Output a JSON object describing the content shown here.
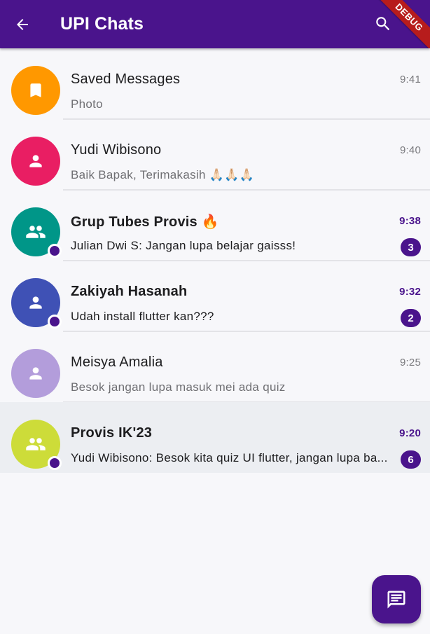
{
  "app_bar": {
    "title": "UPI Chats",
    "back_icon": "arrow-back-icon",
    "search_icon": "search-icon",
    "debug_label": "DEBUG",
    "background": "#4a148c"
  },
  "chats": [
    {
      "name": "Saved Messages",
      "message": "Photo",
      "time": "9:41",
      "avatar_icon": "bookmark-icon",
      "avatar_color": "#ff9800",
      "online": false,
      "unread": ""
    },
    {
      "name": "Yudi Wibisono",
      "message": "Baik Bapak, Terimakasih 🙏🏻🙏🏻🙏🏻",
      "time": "9:40",
      "avatar_icon": "person-icon",
      "avatar_color": "#e91e63",
      "online": false,
      "unread": ""
    },
    {
      "name": "Grup Tubes Provis 🔥",
      "message": "Julian Dwi S: Jangan lupa belajar gaisss!",
      "time": "9:38",
      "avatar_icon": "group-icon",
      "avatar_color": "#009688",
      "online": true,
      "unread": "3"
    },
    {
      "name": "Zakiyah Hasanah",
      "message": "Udah install flutter kan???",
      "time": "9:32",
      "avatar_icon": "person-icon",
      "avatar_color": "#3f51b5",
      "online": true,
      "unread": "2"
    },
    {
      "name": "Meisya Amalia",
      "message": "Besok jangan lupa masuk mei ada quiz",
      "time": "9:25",
      "avatar_icon": "person-icon",
      "avatar_color": "#b39ddb",
      "online": false,
      "unread": ""
    },
    {
      "name": "Provis IK'23",
      "message": "Yudi Wibisono: Besok kita quiz UI flutter, jangan lupa ba...",
      "time": "9:20",
      "avatar_icon": "group-icon",
      "avatar_color": "#cddc39",
      "online": true,
      "unread": "6",
      "selected": true
    }
  ],
  "fab": {
    "icon": "chat-icon"
  }
}
